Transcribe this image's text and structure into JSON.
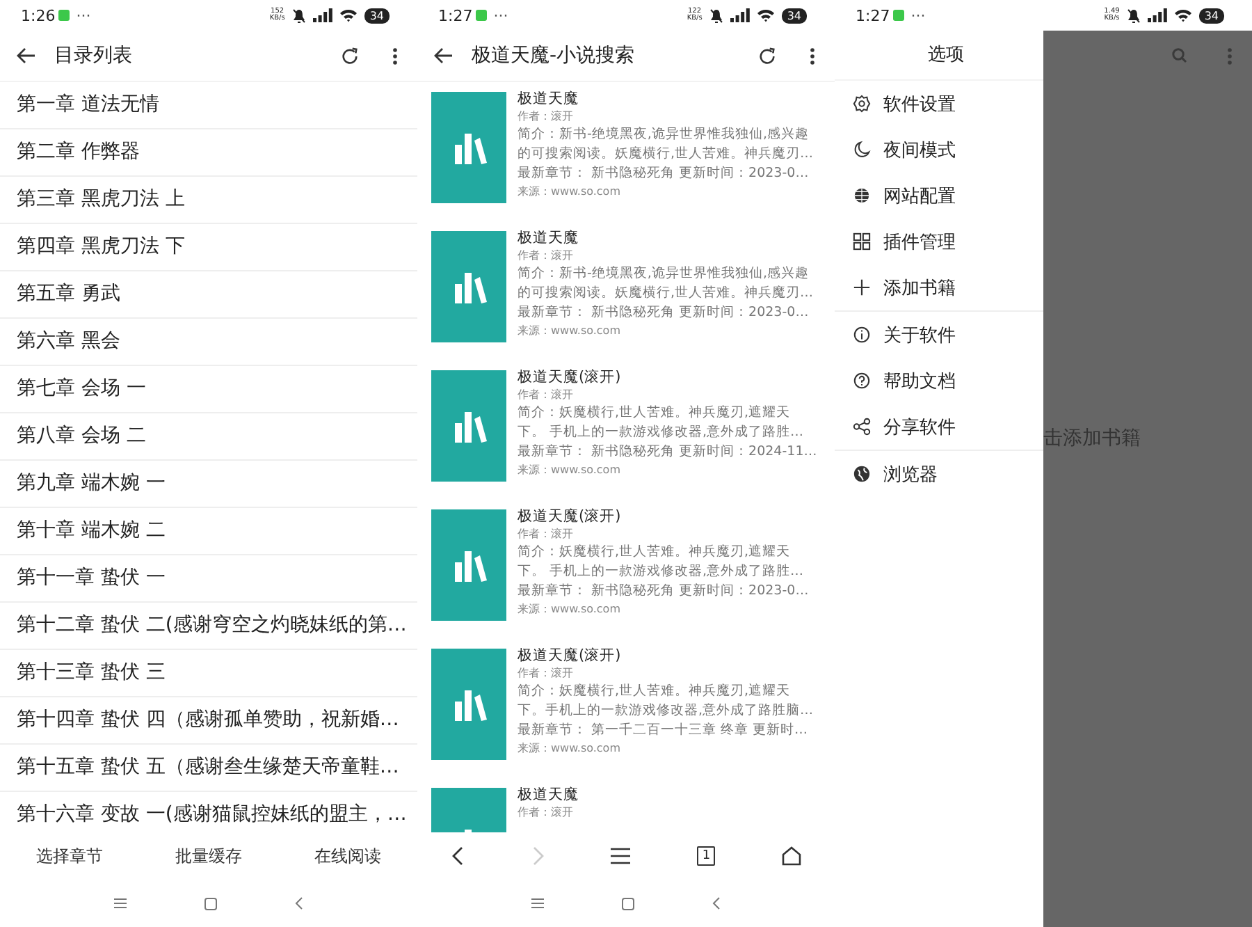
{
  "screens": [
    {
      "status_bar": {
        "time": "1:26",
        "dots": "···",
        "speed": "152\nKB/s",
        "battery": "34"
      },
      "app_bar": {
        "title": "目录列表"
      },
      "chapters": [
        "第一章 道法无情",
        "第二章 作弊器",
        "第三章 黑虎刀法 上",
        "第四章 黑虎刀法 下",
        "第五章 勇武",
        "第六章 黑会",
        "第七章 会场 一",
        "第八章 会场 二",
        "第九章 端木婉 一",
        "第十章 端木婉 二",
        "第十一章 蛰伏 一",
        "第十二章 蛰伏 二(感谢穹空之灼晓妹纸的第…",
        "第十三章 蛰伏 三",
        "第十四章 蛰伏 四（感谢孤单赞助，祝新婚…",
        "第十五章 蛰伏 五（感谢叁生缘楚天帝童鞋…",
        "第十六章 变故 一(感谢猫鼠控妹纸的盟主，…"
      ],
      "bottom_actions": [
        "选择章节",
        "批量缓存",
        "在线阅读"
      ]
    },
    {
      "status_bar": {
        "time": "1:27",
        "dots": "···",
        "speed": "122\nKB/s",
        "battery": "34"
      },
      "app_bar": {
        "title": "极道天魔-小说搜索"
      },
      "results": [
        {
          "title": "极道天魔",
          "author": "作者：滚开",
          "intro": [
            "简介：新书-绝境黑夜,诡异世界惟我独仙,感兴趣",
            "的可搜索阅读。妖魔横行,世人苦难。神兵魔刃…"
          ],
          "latest": "最新章节：  新书隐秘死角 更新时间：2023-0…",
          "source": "来源：www.so.com"
        },
        {
          "title": "极道天魔",
          "author": "作者：滚开",
          "intro": [
            "简介：新书-绝境黑夜,诡异世界惟我独仙,感兴趣",
            "的可搜索阅读。妖魔横行,世人苦难。神兵魔刃…"
          ],
          "latest": "最新章节：  新书隐秘死角 更新时间：2023-0…",
          "source": "来源：www.so.com"
        },
        {
          "title": "极道天魔(滚开)",
          "author": "作者：滚开",
          "intro": [
            "简介：妖魔横行,世人苦难。神兵魔刃,遮耀天",
            "下。 手机上的一款游戏修改器,意外成了路胜…"
          ],
          "latest": "最新章节：  新书隐秘死角 更新时间：2024-11…",
          "source": "来源：www.so.com"
        },
        {
          "title": "极道天魔(滚开)",
          "author": "作者：滚开",
          "intro": [
            "简介：妖魔横行,世人苦难。神兵魔刃,遮耀天",
            "下。 手机上的一款游戏修改器,意外成了路胜…"
          ],
          "latest": "最新章节：  新书隐秘死角 更新时间：2023-0…",
          "source": "来源：www.so.com"
        },
        {
          "title": "极道天魔(滚开)",
          "author": "作者：滚开",
          "intro": [
            "简介：妖魔横行,世人苦难。神兵魔刃,遮耀天",
            "下。手机上的一款游戏修改器,意外成了路胜脑…"
          ],
          "latest": "最新章节：  第一千二百一十三章 终章 更新时…",
          "source": "来源：www.so.com"
        },
        {
          "title": "极道天魔",
          "author": "作者：滚开"
        }
      ],
      "browser_nav": {
        "back_disabled": false,
        "forward_disabled": true,
        "tab_count": "1"
      }
    },
    {
      "status_bar": {
        "time": "1:27",
        "dots": "···",
        "speed": "1.49\nKB/s",
        "battery": "34"
      },
      "drawer": {
        "title": "选项",
        "items": [
          {
            "label": "软件设置",
            "divider_after": false
          },
          {
            "label": "夜间模式",
            "divider_after": false
          },
          {
            "label": "网站配置",
            "divider_after": false
          },
          {
            "label": "插件管理",
            "divider_after": false
          },
          {
            "label": "添加书籍",
            "divider_after": true
          },
          {
            "label": "关于软件",
            "divider_after": false
          },
          {
            "label": "帮助文档",
            "divider_after": false
          },
          {
            "label": "分享软件",
            "divider_after": true
          },
          {
            "label": "浏览器",
            "divider_after": false
          }
        ]
      },
      "empty_hint": "击添加书籍"
    }
  ]
}
